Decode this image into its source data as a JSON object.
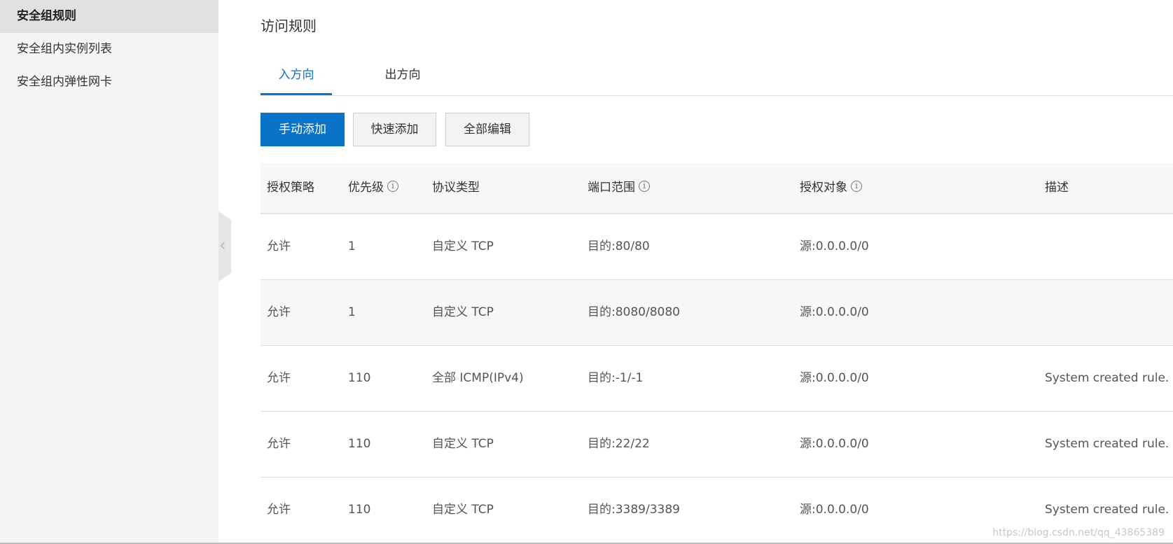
{
  "sidebar": {
    "items": [
      {
        "label": "安全组规则",
        "active": true
      },
      {
        "label": "安全组内实例列表",
        "active": false
      },
      {
        "label": "安全组内弹性网卡",
        "active": false
      }
    ]
  },
  "collapse_handle": {
    "glyph": "‹"
  },
  "main": {
    "title": "访问规则",
    "tabs": [
      {
        "label": "入方向",
        "active": true
      },
      {
        "label": "出方向",
        "active": false
      }
    ],
    "toolbar": {
      "manual_add": "手动添加",
      "quick_add": "快速添加",
      "edit_all": "全部编辑"
    },
    "table": {
      "columns": [
        "授权策略",
        "优先级",
        "协议类型",
        "端口范围",
        "授权对象",
        "描述"
      ],
      "info_icon_glyph": "i",
      "rows": [
        {
          "policy": "允许",
          "priority": "1",
          "protocol": "自定义 TCP",
          "port": "目的:80/80",
          "source": "源:0.0.0.0/0",
          "desc": ""
        },
        {
          "policy": "允许",
          "priority": "1",
          "protocol": "自定义 TCP",
          "port": "目的:8080/8080",
          "source": "源:0.0.0.0/0",
          "desc": ""
        },
        {
          "policy": "允许",
          "priority": "110",
          "protocol": "全部 ICMP(IPv4)",
          "port": "目的:-1/-1",
          "source": "源:0.0.0.0/0",
          "desc": "System created rule."
        },
        {
          "policy": "允许",
          "priority": "110",
          "protocol": "自定义 TCP",
          "port": "目的:22/22",
          "source": "源:0.0.0.0/0",
          "desc": "System created rule."
        },
        {
          "policy": "允许",
          "priority": "110",
          "protocol": "自定义 TCP",
          "port": "目的:3389/3389",
          "source": "源:0.0.0.0/0",
          "desc": "System created rule."
        }
      ]
    }
  },
  "watermark": "https://blog.csdn.net/qq_43865389",
  "colors": {
    "accent": "#0a72c9",
    "sidebar_bg": "#f5f5f5",
    "active_item_bg": "#e1e1e1"
  }
}
